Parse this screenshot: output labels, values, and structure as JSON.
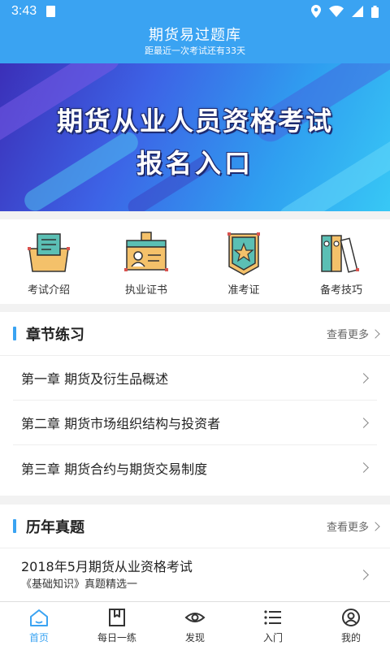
{
  "status_bar": {
    "time": "3:43"
  },
  "header": {
    "title": "期货易过题库",
    "subtitle": "距最近一次考试还有33天"
  },
  "banner": {
    "line1": "期货从业人员资格考试",
    "line2": "报名入口"
  },
  "quick_entries": [
    {
      "label": "考试介绍",
      "icon": "exam-intro-icon"
    },
    {
      "label": "执业证书",
      "icon": "certificate-icon"
    },
    {
      "label": "准考证",
      "icon": "admission-ticket-icon"
    },
    {
      "label": "备考技巧",
      "icon": "study-tips-icon"
    }
  ],
  "chapter_section": {
    "title": "章节练习",
    "more": "查看更多",
    "items": [
      "第一章 期货及衍生品概述",
      "第二章 期货市场组织结构与投资者",
      "第三章 期货合约与期货交易制度"
    ]
  },
  "past_section": {
    "title": "历年真题",
    "more": "查看更多",
    "items": [
      {
        "title": "2018年5月期货从业资格考试",
        "subtitle": "《基础知识》真题精选一"
      }
    ]
  },
  "bottom_nav": [
    {
      "label": "首页",
      "icon": "home-icon",
      "active": true
    },
    {
      "label": "每日一练",
      "icon": "bookmark-book-icon",
      "active": false
    },
    {
      "label": "发现",
      "icon": "eye-icon",
      "active": false
    },
    {
      "label": "入门",
      "icon": "list-icon",
      "active": false
    },
    {
      "label": "我的",
      "icon": "user-icon",
      "active": false
    }
  ],
  "colors": {
    "primary": "#3aa3f2",
    "text": "#222222",
    "background": "#f2f2f2"
  }
}
